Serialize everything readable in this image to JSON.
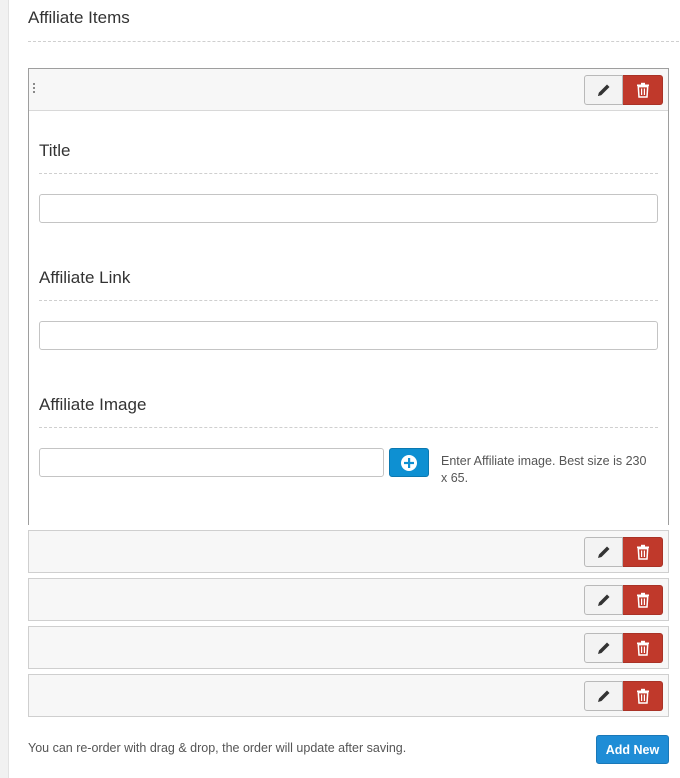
{
  "section": {
    "title": "Affiliate Items"
  },
  "open_item": {
    "fields": {
      "title_label": "Title",
      "title_value": "",
      "link_label": "Affiliate Link",
      "link_value": "",
      "image_label": "Affiliate Image",
      "image_value": "",
      "image_description": "Enter Affiliate image. Best size is 230 x 65."
    }
  },
  "collapsed_item_count": 4,
  "icons": {
    "edit": "pencil-icon",
    "delete": "trash-icon",
    "add_image": "plus-circle-icon",
    "drag": "drag-handle-icon"
  },
  "colors": {
    "delete_button": "#c0392b",
    "add_image_button": "#0e90d2",
    "add_new_button": "#1f8dd6"
  },
  "footer": {
    "note": "You can re-order with drag & drop, the order will update after saving.",
    "add_new_label": "Add New"
  }
}
